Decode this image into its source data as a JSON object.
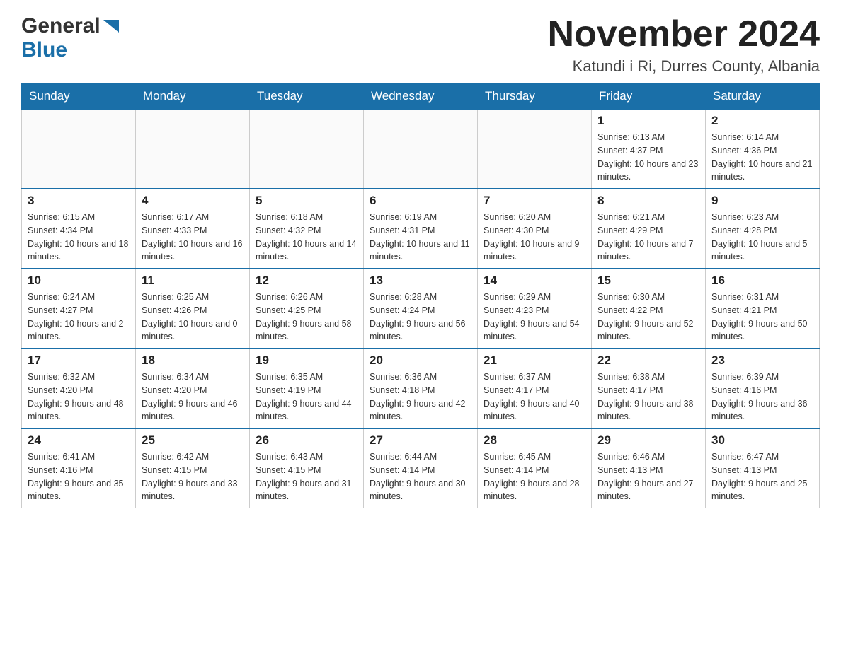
{
  "header": {
    "logo": {
      "general": "General",
      "blue": "Blue",
      "arrow": "▶"
    },
    "title": "November 2024",
    "location": "Katundi i Ri, Durres County, Albania"
  },
  "calendar": {
    "days_of_week": [
      "Sunday",
      "Monday",
      "Tuesday",
      "Wednesday",
      "Thursday",
      "Friday",
      "Saturday"
    ],
    "weeks": [
      {
        "row": 1,
        "cells": [
          {
            "day": "",
            "info": ""
          },
          {
            "day": "",
            "info": ""
          },
          {
            "day": "",
            "info": ""
          },
          {
            "day": "",
            "info": ""
          },
          {
            "day": "",
            "info": ""
          },
          {
            "day": "1",
            "info": "Sunrise: 6:13 AM\nSunset: 4:37 PM\nDaylight: 10 hours and 23 minutes."
          },
          {
            "day": "2",
            "info": "Sunrise: 6:14 AM\nSunset: 4:36 PM\nDaylight: 10 hours and 21 minutes."
          }
        ]
      },
      {
        "row": 2,
        "cells": [
          {
            "day": "3",
            "info": "Sunrise: 6:15 AM\nSunset: 4:34 PM\nDaylight: 10 hours and 18 minutes."
          },
          {
            "day": "4",
            "info": "Sunrise: 6:17 AM\nSunset: 4:33 PM\nDaylight: 10 hours and 16 minutes."
          },
          {
            "day": "5",
            "info": "Sunrise: 6:18 AM\nSunset: 4:32 PM\nDaylight: 10 hours and 14 minutes."
          },
          {
            "day": "6",
            "info": "Sunrise: 6:19 AM\nSunset: 4:31 PM\nDaylight: 10 hours and 11 minutes."
          },
          {
            "day": "7",
            "info": "Sunrise: 6:20 AM\nSunset: 4:30 PM\nDaylight: 10 hours and 9 minutes."
          },
          {
            "day": "8",
            "info": "Sunrise: 6:21 AM\nSunset: 4:29 PM\nDaylight: 10 hours and 7 minutes."
          },
          {
            "day": "9",
            "info": "Sunrise: 6:23 AM\nSunset: 4:28 PM\nDaylight: 10 hours and 5 minutes."
          }
        ]
      },
      {
        "row": 3,
        "cells": [
          {
            "day": "10",
            "info": "Sunrise: 6:24 AM\nSunset: 4:27 PM\nDaylight: 10 hours and 2 minutes."
          },
          {
            "day": "11",
            "info": "Sunrise: 6:25 AM\nSunset: 4:26 PM\nDaylight: 10 hours and 0 minutes."
          },
          {
            "day": "12",
            "info": "Sunrise: 6:26 AM\nSunset: 4:25 PM\nDaylight: 9 hours and 58 minutes."
          },
          {
            "day": "13",
            "info": "Sunrise: 6:28 AM\nSunset: 4:24 PM\nDaylight: 9 hours and 56 minutes."
          },
          {
            "day": "14",
            "info": "Sunrise: 6:29 AM\nSunset: 4:23 PM\nDaylight: 9 hours and 54 minutes."
          },
          {
            "day": "15",
            "info": "Sunrise: 6:30 AM\nSunset: 4:22 PM\nDaylight: 9 hours and 52 minutes."
          },
          {
            "day": "16",
            "info": "Sunrise: 6:31 AM\nSunset: 4:21 PM\nDaylight: 9 hours and 50 minutes."
          }
        ]
      },
      {
        "row": 4,
        "cells": [
          {
            "day": "17",
            "info": "Sunrise: 6:32 AM\nSunset: 4:20 PM\nDaylight: 9 hours and 48 minutes."
          },
          {
            "day": "18",
            "info": "Sunrise: 6:34 AM\nSunset: 4:20 PM\nDaylight: 9 hours and 46 minutes."
          },
          {
            "day": "19",
            "info": "Sunrise: 6:35 AM\nSunset: 4:19 PM\nDaylight: 9 hours and 44 minutes."
          },
          {
            "day": "20",
            "info": "Sunrise: 6:36 AM\nSunset: 4:18 PM\nDaylight: 9 hours and 42 minutes."
          },
          {
            "day": "21",
            "info": "Sunrise: 6:37 AM\nSunset: 4:17 PM\nDaylight: 9 hours and 40 minutes."
          },
          {
            "day": "22",
            "info": "Sunrise: 6:38 AM\nSunset: 4:17 PM\nDaylight: 9 hours and 38 minutes."
          },
          {
            "day": "23",
            "info": "Sunrise: 6:39 AM\nSunset: 4:16 PM\nDaylight: 9 hours and 36 minutes."
          }
        ]
      },
      {
        "row": 5,
        "cells": [
          {
            "day": "24",
            "info": "Sunrise: 6:41 AM\nSunset: 4:16 PM\nDaylight: 9 hours and 35 minutes."
          },
          {
            "day": "25",
            "info": "Sunrise: 6:42 AM\nSunset: 4:15 PM\nDaylight: 9 hours and 33 minutes."
          },
          {
            "day": "26",
            "info": "Sunrise: 6:43 AM\nSunset: 4:15 PM\nDaylight: 9 hours and 31 minutes."
          },
          {
            "day": "27",
            "info": "Sunrise: 6:44 AM\nSunset: 4:14 PM\nDaylight: 9 hours and 30 minutes."
          },
          {
            "day": "28",
            "info": "Sunrise: 6:45 AM\nSunset: 4:14 PM\nDaylight: 9 hours and 28 minutes."
          },
          {
            "day": "29",
            "info": "Sunrise: 6:46 AM\nSunset: 4:13 PM\nDaylight: 9 hours and 27 minutes."
          },
          {
            "day": "30",
            "info": "Sunrise: 6:47 AM\nSunset: 4:13 PM\nDaylight: 9 hours and 25 minutes."
          }
        ]
      }
    ]
  },
  "colors": {
    "header_bg": "#1a6fa8",
    "header_text": "#ffffff",
    "border": "#cccccc",
    "day_number": "#222222",
    "day_info": "#333333"
  }
}
